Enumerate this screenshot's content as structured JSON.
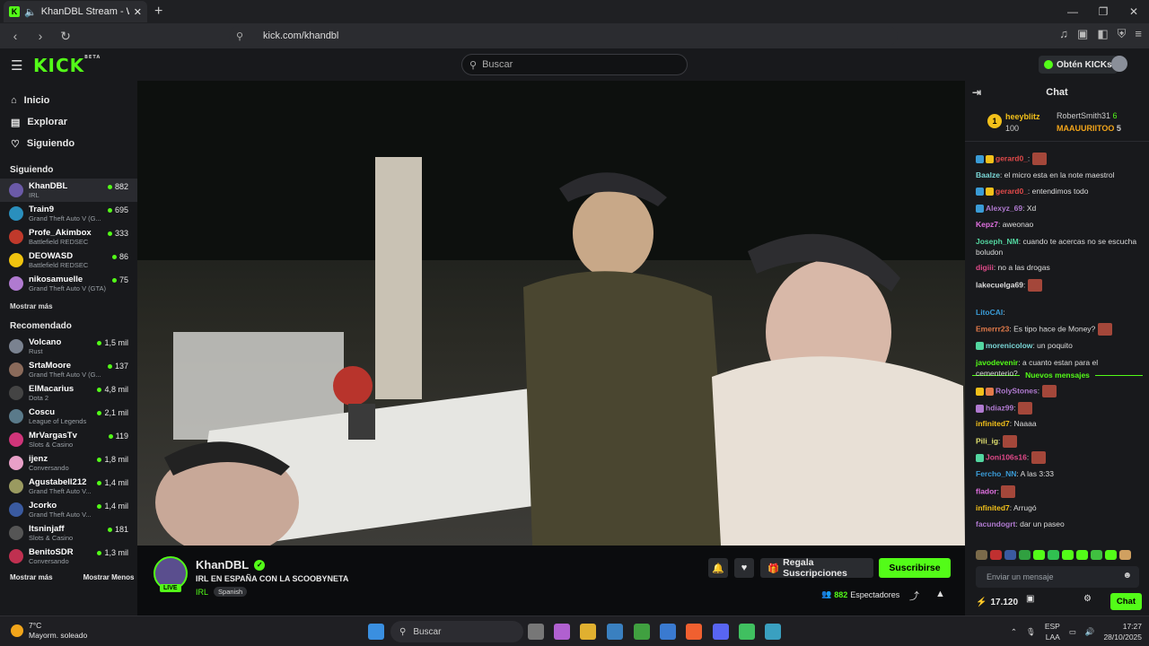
{
  "browser": {
    "tab_title": "KhanDBL Stream - Watch Live",
    "url": "kick.com/khandbl"
  },
  "header": {
    "logo": "KICK",
    "beta": "BETA",
    "search_placeholder": "Buscar",
    "kicks_label": "Obtén KICKs"
  },
  "sidebar": {
    "nav": [
      {
        "label": "Inicio",
        "icon": "home-icon"
      },
      {
        "label": "Explorar",
        "icon": "compass-icon"
      },
      {
        "label": "Siguiendo",
        "icon": "heart-icon"
      }
    ],
    "following_title": "Siguiendo",
    "following": [
      {
        "name": "KhanDBL",
        "game": "IRL",
        "viewers": "882",
        "color": "#6b5aa8"
      },
      {
        "name": "Train9",
        "game": "Grand Theft Auto V (G...",
        "viewers": "695",
        "color": "#2a8fbd"
      },
      {
        "name": "Profe_Akimbox",
        "game": "Battlefield REDSEC",
        "viewers": "333",
        "color": "#c0392b"
      },
      {
        "name": "DEOWASD",
        "game": "Battlefield REDSEC",
        "viewers": "86",
        "color": "#f1c40f"
      },
      {
        "name": "nikosamuelle",
        "game": "Grand Theft Auto V (GTA)",
        "viewers": "75",
        "color": "#b07ad0"
      }
    ],
    "show_more": "Mostrar más",
    "recommended_title": "Recomendado",
    "recommended": [
      {
        "name": "Volcano",
        "game": "Rust",
        "viewers": "1,5 mil",
        "color": "#7a8290"
      },
      {
        "name": "SrtaMoore",
        "game": "Grand Theft Auto V (G...",
        "viewers": "137",
        "color": "#8a6a5a"
      },
      {
        "name": "ElMacarius",
        "game": "Dota 2",
        "viewers": "4,8 mil",
        "color": "#444"
      },
      {
        "name": "Coscu",
        "game": "League of Legends",
        "viewers": "2,1 mil",
        "color": "#5a7a8a"
      },
      {
        "name": "MrVargasTv",
        "game": "Slots & Casino",
        "viewers": "119",
        "color": "#d0357a"
      },
      {
        "name": "ijenz",
        "game": "Conversando",
        "viewers": "1,8 mil",
        "color": "#e8a0c8"
      },
      {
        "name": "Agustabell212",
        "game": "Grand Theft Auto V...",
        "viewers": "1,4 mil",
        "color": "#9a9a60"
      },
      {
        "name": "Jcorko",
        "game": "Grand Theft Auto V...",
        "viewers": "1,4 mil",
        "color": "#3a5aa0"
      },
      {
        "name": "Itsninjaff",
        "game": "Slots & Casino",
        "viewers": "181",
        "color": "#555"
      },
      {
        "name": "BenitoSDR",
        "game": "Conversando",
        "viewers": "1,3 mil",
        "color": "#c03050"
      }
    ],
    "show_more2": "Mostrar más",
    "show_less": "Mostrar Menos"
  },
  "stream": {
    "live": "LIVE",
    "streamer": "KhanDBL",
    "title": "IRL EN ESPAÑA CON LA SCOOBYNETA",
    "category": "IRL",
    "language": "Spanish",
    "gift_label": "Regala Suscripciones",
    "subscribe_label": "Suscribirse",
    "viewers_count": "882",
    "viewers_label": "Espectadores"
  },
  "chat": {
    "title": "Chat",
    "pinned": {
      "rank": "1",
      "top_user": "heeyblitz",
      "top_points": "100",
      "second_user": "RobertSmith31",
      "second_count": "6",
      "third_user": "MAAUURIITOO",
      "third_count": "5"
    },
    "messages": [
      {
        "user": "gerard0_",
        "text": "",
        "color": "#e24a4a",
        "emote": true,
        "badges": [
          "#3a9bd6",
          "#f2c01a"
        ]
      },
      {
        "user": "Baalze",
        "text": "el micro esta en la note maestrol",
        "color": "#7ad6d6",
        "emote": false,
        "badges": []
      },
      {
        "user": "gerard0_",
        "text": "entendimos todo",
        "color": "#e24a4a",
        "emote": false,
        "badges": [
          "#3a9bd6",
          "#f2c01a"
        ]
      },
      {
        "user": "Alexyz_69",
        "text": "Xd",
        "color": "#b07ad0",
        "emote": false,
        "badges": [
          "#3a9bd6"
        ]
      },
      {
        "user": "Kepz7",
        "text": "aweonao",
        "color": "#e070e0",
        "emote": false,
        "badges": []
      },
      {
        "user": "Joseph_NM",
        "text": "cuando te acercas no se escucha boludon",
        "color": "#53d6a0",
        "emote": false,
        "badges": []
      },
      {
        "user": "digiii",
        "text": "no a las drogas",
        "color": "#e24a8a",
        "emote": false,
        "badges": []
      },
      {
        "user": "lakecuelga69",
        "text": "",
        "color": "#ddd",
        "emote": true,
        "badges": []
      },
      {
        "user": "LitoCAI",
        "text": "",
        "color": "#3a9bd6",
        "emote": false,
        "badges": []
      },
      {
        "user": "Emerrr23",
        "text": "Es tipo hace de Money?",
        "color": "#e27a4a",
        "emote": true,
        "badges": []
      },
      {
        "user": "morenicolow",
        "text": "un poquito",
        "color": "#7ad6d6",
        "emote": false,
        "badges": [
          "#53d6a0"
        ]
      },
      {
        "user": "javodevenir",
        "text": "a cuanto estan para el cementerio?",
        "color": "#53fc18",
        "emote": false,
        "badges": []
      },
      {
        "user": "RolyStones",
        "text": "",
        "color": "#b07ad0",
        "emote": true,
        "badges": [
          "#f2c01a",
          "#e27a4a"
        ]
      },
      {
        "user": "hdiaz99",
        "text": "",
        "color": "#b07ad0",
        "emote": true,
        "badges": [
          "#b07ad0"
        ]
      },
      {
        "user": "infinited7",
        "text": "Naaaa",
        "color": "#f2c01a",
        "emote": false,
        "badges": []
      },
      {
        "user": "Pili_ig",
        "text": "",
        "color": "#e0e070",
        "emote": true,
        "badges": []
      },
      {
        "user": "Joni106s16",
        "text": "",
        "color": "#e24a8a",
        "emote": true,
        "badges": [
          "#53d6a0"
        ]
      },
      {
        "user": "Fercho_NN",
        "text": "A las 3:33",
        "color": "#3a9bd6",
        "emote": false,
        "badges": []
      },
      {
        "user": "flador",
        "text": "",
        "color": "#e070e0",
        "emote": true,
        "badges": []
      },
      {
        "user": "infinited7",
        "text": "Arrugó",
        "color": "#f2c01a",
        "emote": false,
        "badges": []
      },
      {
        "user": "facundogrt",
        "text": "dar un paseo",
        "color": "#b07ad0",
        "emote": false,
        "badges": []
      }
    ],
    "new_messages": "Nuevos mensajes",
    "input_placeholder": "Enviar un mensaje",
    "points": "17.120",
    "chat_button": "Chat"
  },
  "taskbar": {
    "temp": "7°C",
    "weather": "Mayorm. soleado",
    "search": "Buscar",
    "lang1": "ESP",
    "lang2": "LAA",
    "time": "17:27",
    "date": "28/10/2025"
  }
}
